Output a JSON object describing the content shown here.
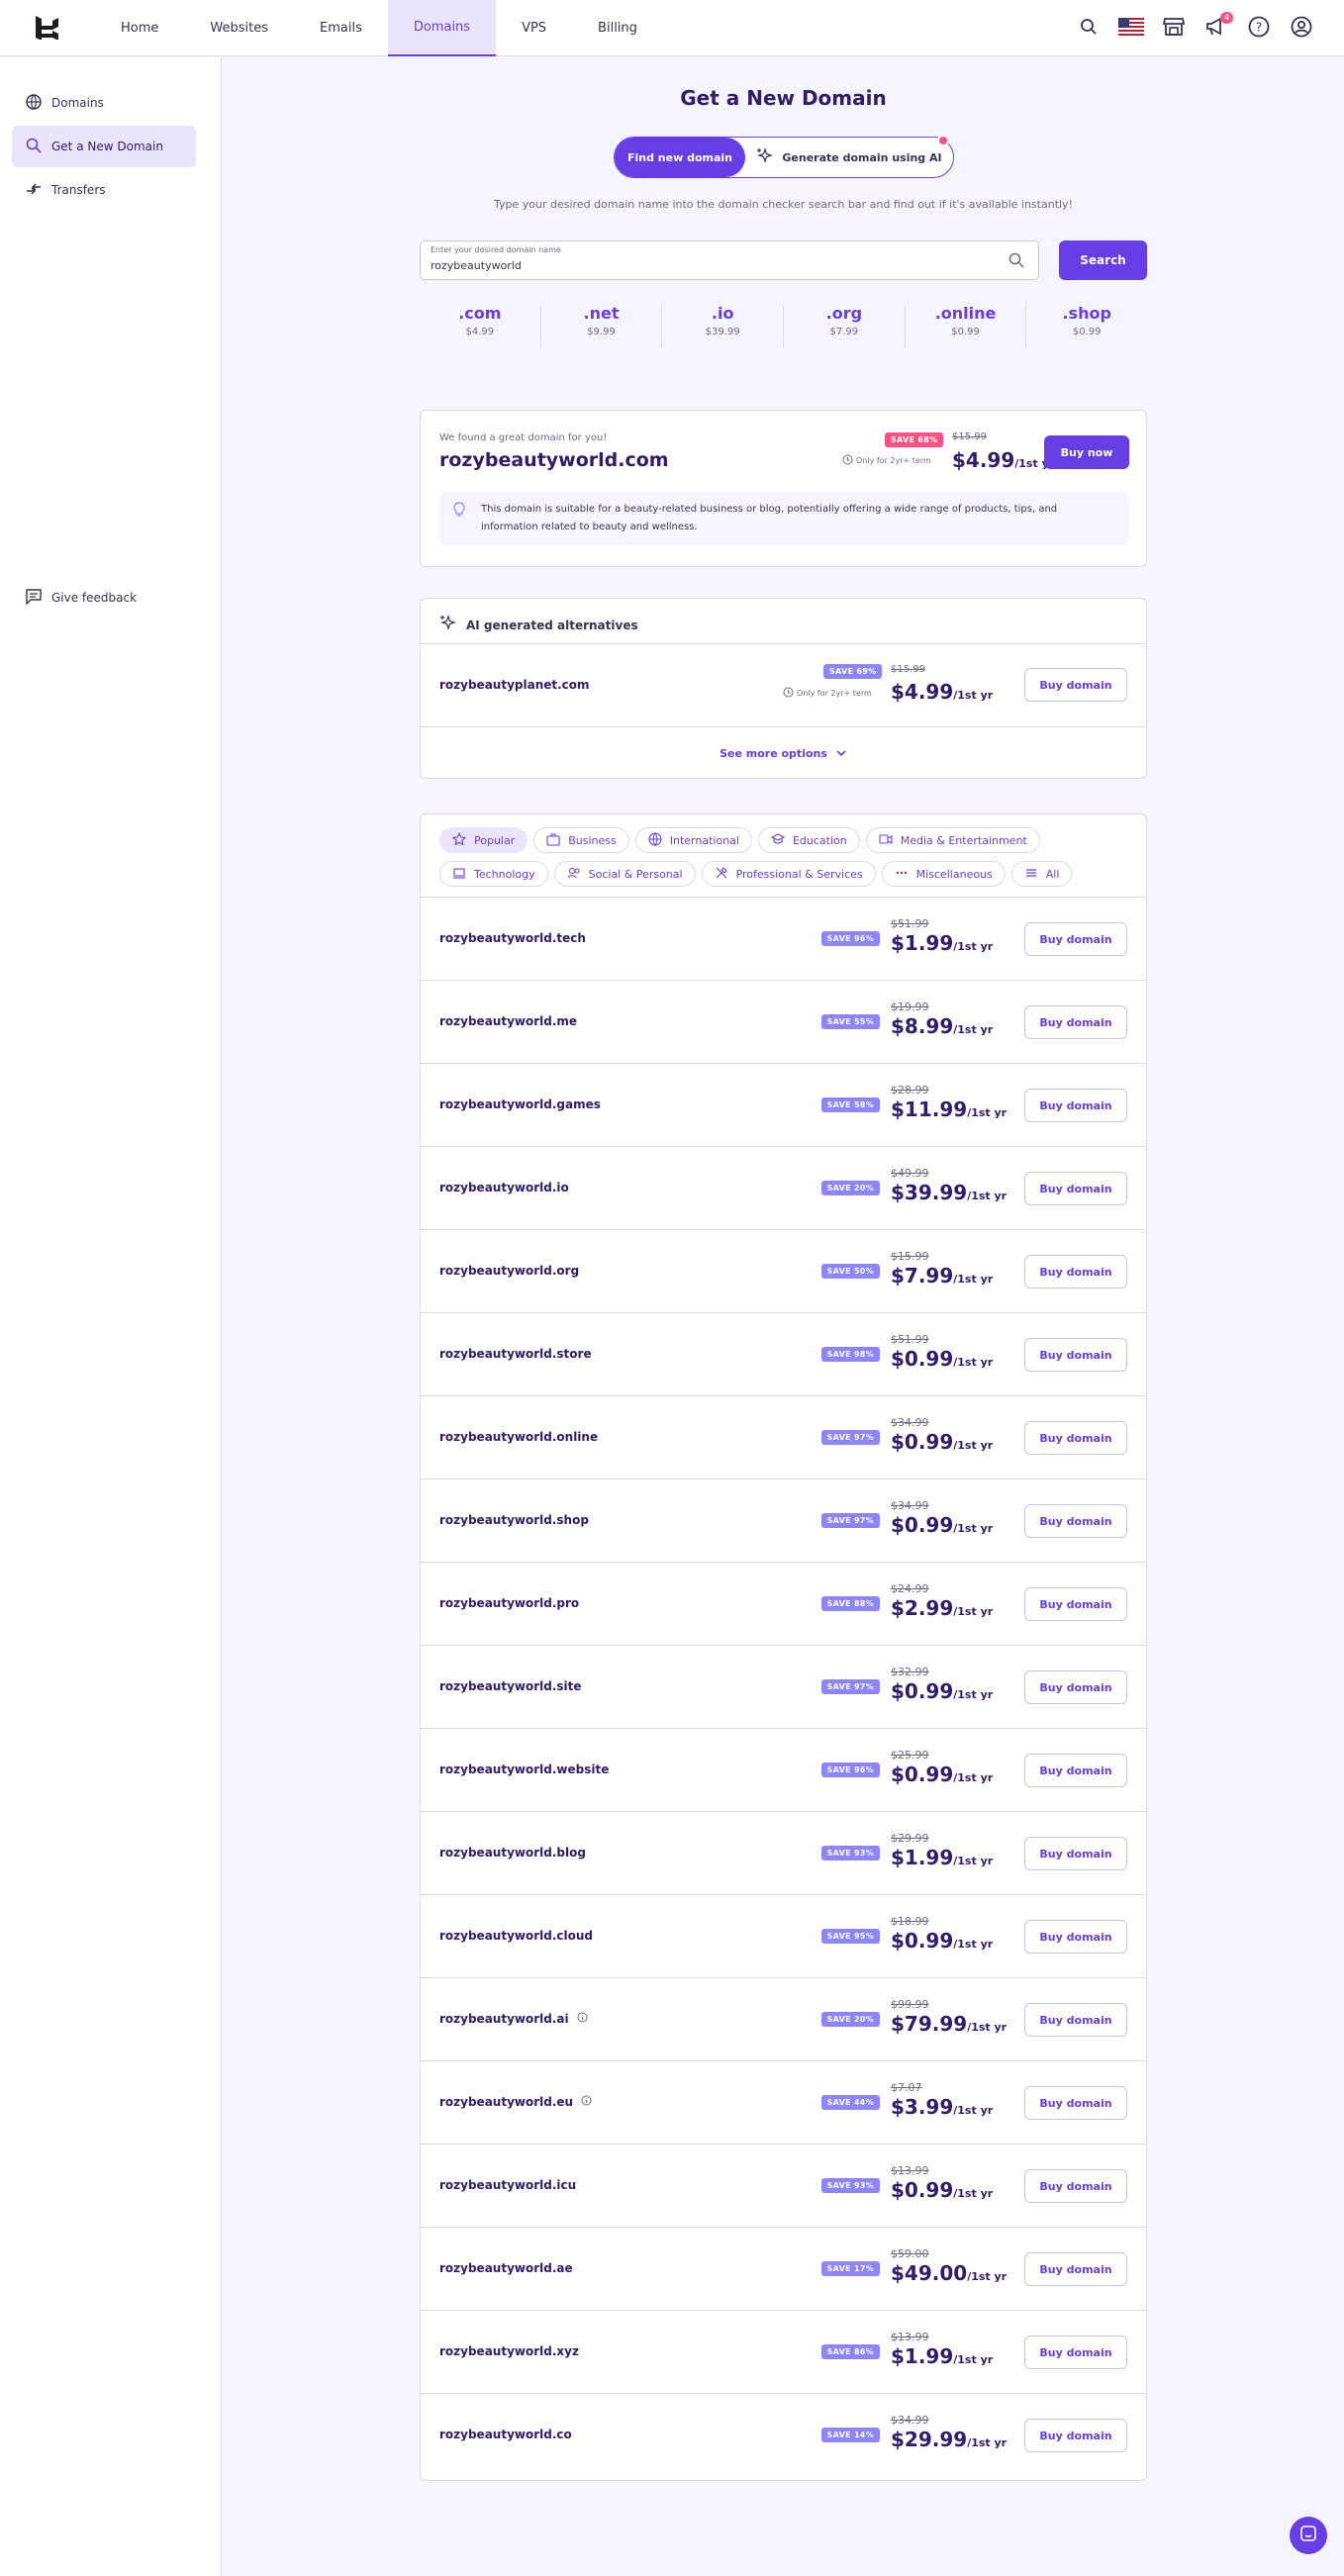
{
  "nav": {
    "items": [
      "Home",
      "Websites",
      "Emails",
      "Domains",
      "VPS",
      "Billing"
    ],
    "active": "Domains",
    "notifications_count": "4"
  },
  "sidebar": {
    "items": [
      "Domains",
      "Get a New Domain",
      "Transfers"
    ],
    "active": "Get a New Domain",
    "feedback": "Give feedback"
  },
  "page": {
    "title": "Get a New Domain",
    "toggle": {
      "find": "Find new domain",
      "generate": "Generate domain using AI"
    },
    "hint": "Type your desired domain name into the domain checker search bar and find out if it's available instantly!",
    "search": {
      "label": "Enter your desired domain name",
      "value": "rozybeautyworld",
      "button": "Search"
    }
  },
  "tlds": [
    {
      "name": ".com",
      "price": "$4.99"
    },
    {
      "name": ".net",
      "price": "$9.99"
    },
    {
      "name": ".io",
      "price": "$39.99"
    },
    {
      "name": ".org",
      "price": "$7.99"
    },
    {
      "name": ".online",
      "price": "$0.99"
    },
    {
      "name": ".shop",
      "price": "$0.99"
    }
  ],
  "featured": {
    "intro": "We found a great domain for you!",
    "domain": "rozybeautyworld.com",
    "save": "SAVE 68%",
    "old_price": "$15.99",
    "term": "Only for 2yr+ term",
    "new_price": "$4.99",
    "per": "/1st yr",
    "button": "Buy now",
    "description": "This domain is suitable for a beauty-related business or blog, potentially offering a wide range of products, tips, and information related to beauty and wellness."
  },
  "ai_alternatives": {
    "title": "AI generated alternatives",
    "item": {
      "domain": "rozybeautyplanet.com",
      "save": "SAVE 69%",
      "old_price": "$15.99",
      "term": "Only for 2yr+ term",
      "new_price": "$4.99",
      "per": "/1st yr",
      "button": "Buy domain"
    },
    "see_more": "See more options"
  },
  "filters": [
    "Popular",
    "Business",
    "International",
    "Education",
    "Media & Entertainment",
    "Technology",
    "Social & Personal",
    "Professional & Services",
    "Miscellaneous",
    "All"
  ],
  "domains": [
    {
      "name": "rozybeautyworld.tech",
      "save": "SAVE 96%",
      "old": "$51.99",
      "price": "$1.99",
      "info": false
    },
    {
      "name": "rozybeautyworld.me",
      "save": "SAVE 55%",
      "old": "$19.99",
      "price": "$8.99",
      "info": false
    },
    {
      "name": "rozybeautyworld.games",
      "save": "SAVE 58%",
      "old": "$28.99",
      "price": "$11.99",
      "info": false
    },
    {
      "name": "rozybeautyworld.io",
      "save": "SAVE 20%",
      "old": "$49.99",
      "price": "$39.99",
      "info": false
    },
    {
      "name": "rozybeautyworld.org",
      "save": "SAVE 50%",
      "old": "$15.99",
      "price": "$7.99",
      "info": false
    },
    {
      "name": "rozybeautyworld.store",
      "save": "SAVE 98%",
      "old": "$51.99",
      "price": "$0.99",
      "info": false
    },
    {
      "name": "rozybeautyworld.online",
      "save": "SAVE 97%",
      "old": "$34.99",
      "price": "$0.99",
      "info": false
    },
    {
      "name": "rozybeautyworld.shop",
      "save": "SAVE 97%",
      "old": "$34.99",
      "price": "$0.99",
      "info": false
    },
    {
      "name": "rozybeautyworld.pro",
      "save": "SAVE 88%",
      "old": "$24.99",
      "price": "$2.99",
      "info": false
    },
    {
      "name": "rozybeautyworld.site",
      "save": "SAVE 97%",
      "old": "$32.99",
      "price": "$0.99",
      "info": false
    },
    {
      "name": "rozybeautyworld.website",
      "save": "SAVE 96%",
      "old": "$25.99",
      "price": "$0.99",
      "info": false
    },
    {
      "name": "rozybeautyworld.blog",
      "save": "SAVE 93%",
      "old": "$29.99",
      "price": "$1.99",
      "info": false
    },
    {
      "name": "rozybeautyworld.cloud",
      "save": "SAVE 95%",
      "old": "$18.99",
      "price": "$0.99",
      "info": false
    },
    {
      "name": "rozybeautyworld.ai",
      "save": "SAVE 20%",
      "old": "$99.99",
      "price": "$79.99",
      "info": true
    },
    {
      "name": "rozybeautyworld.eu",
      "save": "SAVE 44%",
      "old": "$7.07",
      "price": "$3.99",
      "info": true
    },
    {
      "name": "rozybeautyworld.icu",
      "save": "SAVE 93%",
      "old": "$13.99",
      "price": "$0.99",
      "info": false
    },
    {
      "name": "rozybeautyworld.ae",
      "save": "SAVE 17%",
      "old": "$59.00",
      "price": "$49.00",
      "info": false
    },
    {
      "name": "rozybeautyworld.xyz",
      "save": "SAVE 86%",
      "old": "$13.99",
      "price": "$1.99",
      "info": false
    },
    {
      "name": "rozybeautyworld.co",
      "save": "SAVE 14%",
      "old": "$34.99",
      "price": "$29.99",
      "info": false
    }
  ],
  "per_year": "/1st yr",
  "buy_label": "Buy domain",
  "colors": {
    "primary": "#673de6",
    "save_badge": "#8c85ff",
    "featured_badge": "#fc5185",
    "text": "#2f1c6a"
  }
}
